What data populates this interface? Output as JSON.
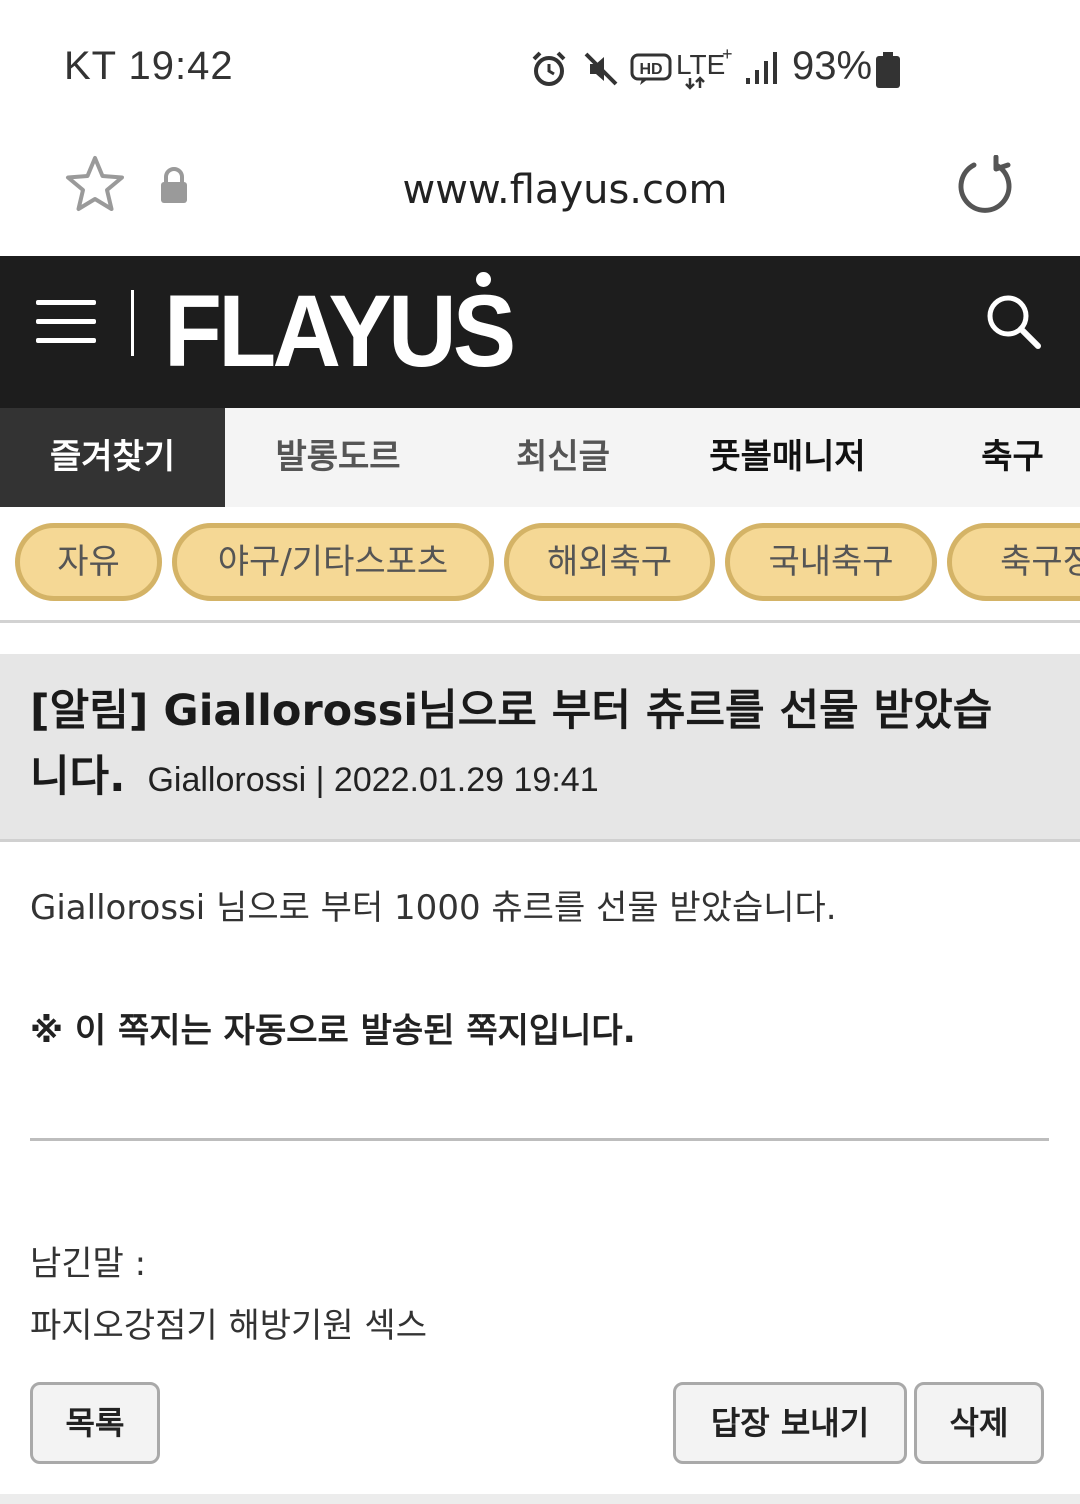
{
  "status_bar": {
    "carrier_time": "KT 19:42",
    "battery": "93%",
    "icons": [
      "alarm-icon",
      "mute-icon",
      "hd-icon",
      "lte-icon",
      "signal-icon",
      "battery-icon"
    ]
  },
  "browser": {
    "url": "www.flayus.com",
    "icons": [
      "star-icon",
      "lock-icon",
      "reload-icon"
    ]
  },
  "header": {
    "logo": "FLAYUS",
    "icons": [
      "hamburger-icon",
      "search-icon"
    ]
  },
  "nav_tabs": [
    "즐겨찾기",
    "발롱도르",
    "최신글",
    "풋볼매니저",
    "축구"
  ],
  "categories": [
    "자유",
    "야구/기타스포츠",
    "해외축구",
    "국내축구",
    "축구정"
  ],
  "message": {
    "title": "[알림] Giallorossi님으로 부터 츄르를 선물 받았습니다.",
    "meta": "Giallorossi | 2022.01.29 19:41",
    "body": "Giallorossi 님으로 부터 1000 츄르를 선물 받았습니다.",
    "notice": "※ 이 쪽지는 자동으로 발송된 쪽지입니다.",
    "memo_label": "남긴말 :",
    "memo_text": "파지오강점기 해방기원 섹스"
  },
  "buttons": {
    "list": "목록",
    "reply": "답장 보내기",
    "delete": "삭제"
  },
  "colors": {
    "header_bg": "#1d1d1d",
    "pill_fill": "#f5d895",
    "pill_border": "#d4b366",
    "title_bg": "#e6e6e6"
  }
}
